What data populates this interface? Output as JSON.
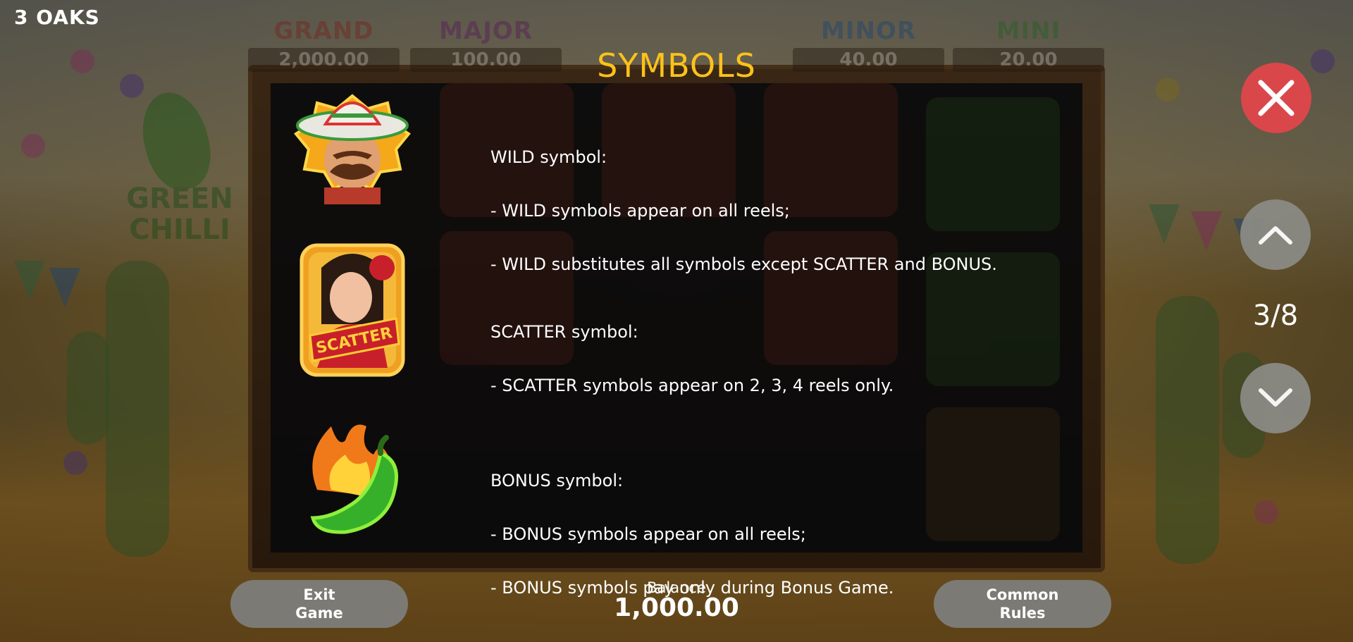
{
  "brand": {
    "logo_text": "3 OAKS"
  },
  "jackpots": [
    {
      "name": "GRAND",
      "value": "2,000.00",
      "color": "#c0392b"
    },
    {
      "name": "MAJOR",
      "value": "100.00",
      "color": "#8e2b8e"
    },
    {
      "name": "MINOR",
      "value": "40.00",
      "color": "#2f6fb5"
    },
    {
      "name": "MINI",
      "value": "20.00",
      "color": "#3d9a3a"
    }
  ],
  "background_logo": {
    "line1": "GREEN",
    "line2": "CHILLI"
  },
  "paytable": {
    "title": "SYMBOLS",
    "symbols": [
      {
        "icon": "wild-mariachi-icon",
        "label": "WILD symbol:",
        "lines": [
          "- WILD symbols appear on all reels;",
          "- WILD substitutes all symbols except SCATTER and BONUS."
        ]
      },
      {
        "icon": "scatter-dancer-icon",
        "badge": "SCATTER",
        "label": "SCATTER symbol:",
        "lines": [
          "- SCATTER symbols appear on 2, 3, 4 reels only."
        ]
      },
      {
        "icon": "bonus-chilli-icon",
        "label": "BONUS symbol:",
        "lines": [
          "- BONUS symbols appear on all reels;",
          "- BONUS symbols pay only during Bonus Game."
        ]
      }
    ]
  },
  "navigation": {
    "close_icon": "close-icon",
    "up_icon": "chevron-up-icon",
    "down_icon": "chevron-down-icon",
    "page": "3/8"
  },
  "footer": {
    "exit_label": "Exit\nGame",
    "balance_label": "Balance",
    "balance_value": "1,000.00",
    "rules_label": "Common\nRules"
  },
  "colors": {
    "title": "#ffc21a",
    "close_button": "#d9474b",
    "nav_button": "#8a8a84",
    "pill_button": "#7c7a74"
  }
}
